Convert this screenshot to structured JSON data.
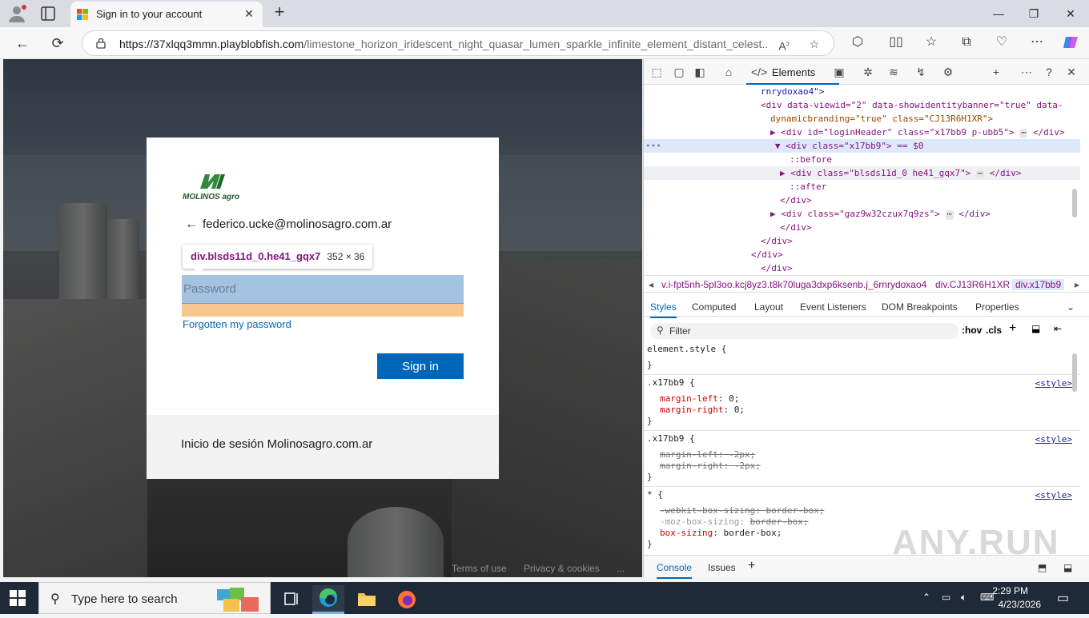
{
  "browser": {
    "tab_title": "Sign in to your account",
    "url_host": "https://37xlqq3mmn.playblobfish.com",
    "url_path": "/limestone_horizon_iridescent_night_quasar_lumen_sparkle_infinite_element_distant_celest..."
  },
  "page": {
    "logo_text": "MOLINOS agro",
    "identity_email": "federico.ucke@molinosagro.com.ar",
    "password_placeholder": "Password",
    "forgot_link": "Forgotten my password",
    "signin_label": "Sign in",
    "footer_text": "Inicio de sesión Molinosagro.com.ar",
    "page_footer_links": [
      "Terms of use",
      "Privacy & cookies",
      "..."
    ],
    "tooltip_name": "div.blsds11d_0.he41_gqx7",
    "tooltip_size": "352 × 36"
  },
  "devtools": {
    "active_tab": "Elements",
    "dom_lines": [
      "rnrydoxao4\">",
      "<div data-viewid=\"2\" data-showidentitybanner=\"true\" data-",
      "dynamicbranding=\"true\" class=\"CJ13R6H1XR\">",
      "<div id=\"loginHeader\" class=\"x17bb9 p-ubb5\">",
      "<div class=\"x17bb9\"> == $0",
      "::before",
      "<div class=\"blsds11d_0 he41_gqx7\">",
      "::after",
      "</div>",
      "<div class=\"gaz9w32czux7q9zs\">",
      "</div>",
      "</div>",
      "</div>",
      "</div>"
    ],
    "breadcrumbs": [
      "v.i-fpt5nh-5pl3oo.kcj8yz3.t8k70luga3dxp6ksenb.j_6rnrydoxao4",
      "div.CJ13R6H1XR",
      "div.x17bb9"
    ],
    "styles_tabs": [
      "Styles",
      "Computed",
      "Layout",
      "Event Listeners",
      "DOM Breakpoints",
      "Properties"
    ],
    "filter_label": "Filter",
    "hov": ":hov",
    "cls": ".cls",
    "rules": {
      "element_style": "element.style {",
      "close": "}",
      "sel1": ".x17bb9 {",
      "sel2": ".x17bb9 {",
      "sel3": "* {",
      "source": "<style>",
      "r1p1": "margin-left",
      "r1v1": "0;",
      "r1p2": "margin-right",
      "r1v2": "0;",
      "r2p1": "margin-left",
      "r2v1": "-2px;",
      "r2p2": "margin-right",
      "r2v2": "-2px;",
      "r3p1": "-webkit-box-sizing",
      "r3v1": "border-box;",
      "r3p2": "-moz-box-sizing",
      "r3v2": "border-box;",
      "r3p3": "box-sizing",
      "r3v3": "border-box;"
    },
    "drawer_tabs": [
      "Console",
      "Issues"
    ]
  },
  "taskbar": {
    "search_placeholder": "Type here to search",
    "time": "2:29 PM",
    "date": "4/23/2026"
  },
  "colors": {
    "brand_blue": "#0067b8",
    "highlight_content": "#a4c2e2",
    "highlight_margin": "#f9c58f",
    "taskbar_bg": "#1f2a38"
  },
  "watermark": "ANY.RUN"
}
